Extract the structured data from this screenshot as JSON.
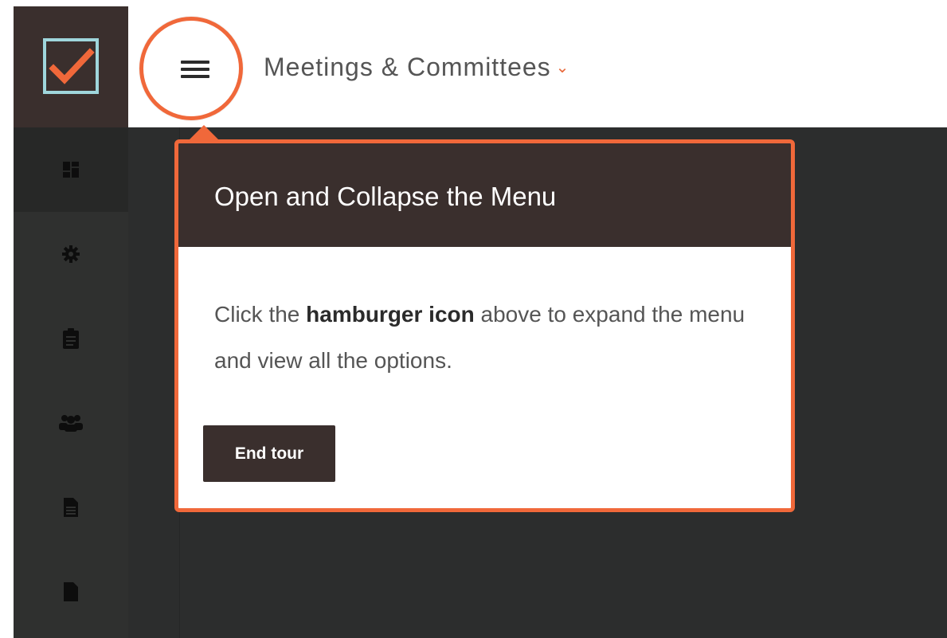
{
  "header": {
    "app_title": "Meetings & Committees",
    "title_caret_glyph": "⌄"
  },
  "sidebar": {
    "items": [
      {
        "icon": "dashboard-icon",
        "active": true
      },
      {
        "icon": "gear-icon",
        "active": false
      },
      {
        "icon": "clipboard-icon",
        "active": false
      },
      {
        "icon": "users-icon",
        "active": false
      },
      {
        "icon": "document-text-icon",
        "active": false
      },
      {
        "icon": "document-icon",
        "active": false
      }
    ]
  },
  "tour": {
    "title": "Open and Collapse the Menu",
    "body_before": "Click the ",
    "body_bold": "hamburger icon",
    "body_after": " above to expand the menu and view all the options.",
    "end_button": "End tour"
  },
  "colors": {
    "accent": "#f0683a",
    "brand_dark": "#3a2f2d",
    "logo_outline": "#9fd6dc",
    "app_background": "#2c2d2d"
  }
}
